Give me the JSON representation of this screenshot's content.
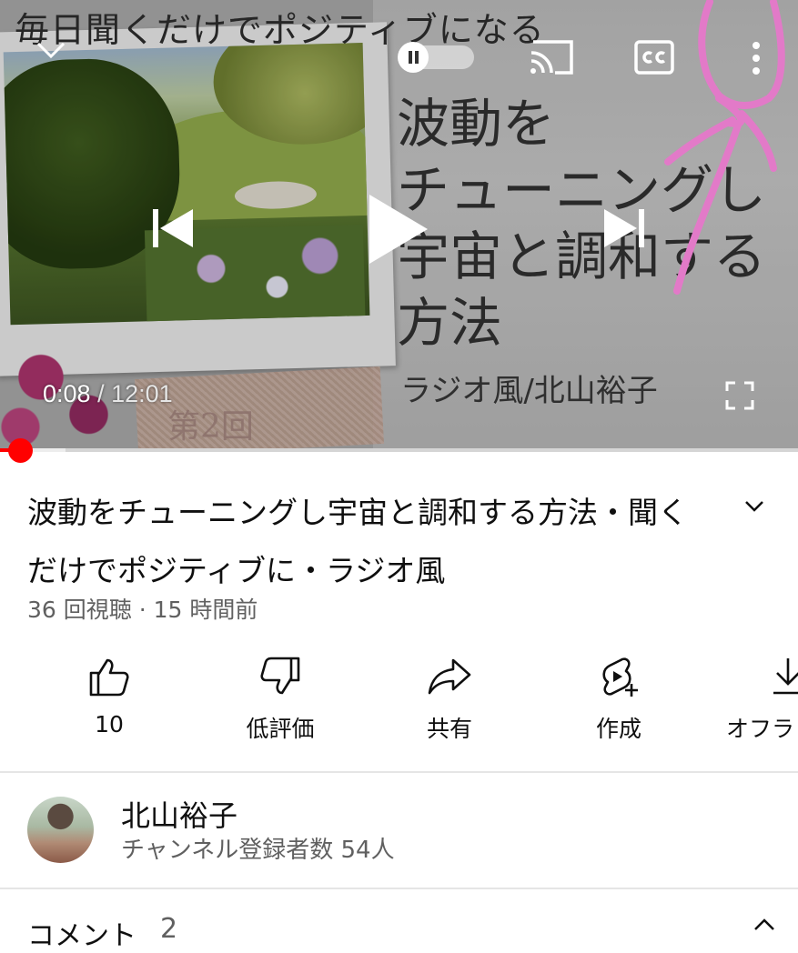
{
  "player": {
    "overlay_title": "毎日聞くだけでポジティブになる",
    "thumbnail_title_lines": [
      "波動を",
      "チューニングし",
      "宇宙と調和する",
      "方法"
    ],
    "thumbnail_credit": "ラジオ風/北山裕子",
    "episode_label": "第2回",
    "current_time": "0:08",
    "separator": " / ",
    "duration": "12:01",
    "progress_fraction": 0.011,
    "buffered_fraction": 0.082,
    "icons": [
      "chevron-down-icon",
      "pause-icon",
      "cast-icon",
      "cc-icon",
      "more-vert-icon",
      "skip-previous-icon",
      "play-icon",
      "skip-next-icon",
      "fullscreen-icon"
    ]
  },
  "video": {
    "title": "波動をチューニングし宇宙と調和する方法・聞くだけでポジティブに・ラジオ風",
    "meta": "36 回視聴 · 15 時間前"
  },
  "actions": [
    {
      "icon": "thumb-up-icon",
      "label": "10"
    },
    {
      "icon": "thumb-down-icon",
      "label": "低評価"
    },
    {
      "icon": "share-icon",
      "label": "共有"
    },
    {
      "icon": "create-icon",
      "label": "作成"
    },
    {
      "icon": "download-icon",
      "label": "オフラ"
    }
  ],
  "channel": {
    "name": "北山裕子",
    "subscribers": "チャンネル登録者数 54人"
  },
  "comments": {
    "label": "コメント",
    "count": "2"
  },
  "colors": {
    "accent_red": "#ff0000",
    "annotation_pink": "#e27ac8",
    "secondary_text": "#606060"
  }
}
